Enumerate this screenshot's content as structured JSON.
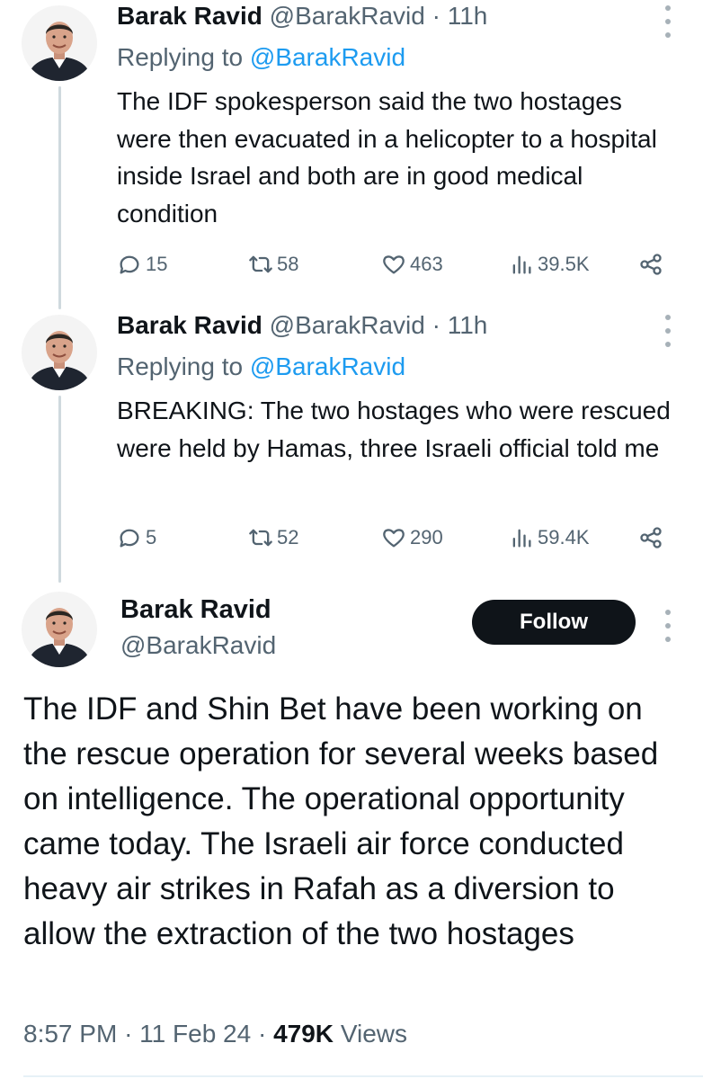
{
  "replies": [
    {
      "name": "Barak Ravid",
      "handle": "@BarakRavid",
      "dot": "·",
      "time": "11h",
      "replying_prefix": "Replying to",
      "replying_to": "@BarakRavid",
      "text": "The IDF spokesperson said the two hostages were then evacuated in a helicopter to a hospital inside Israel and both are in good medical condition",
      "replies_count": "15",
      "retweets_count": "58",
      "likes_count": "463",
      "views_count": "39.5K"
    },
    {
      "name": "Barak Ravid",
      "handle": "@BarakRavid",
      "dot": "·",
      "time": "11h",
      "replying_prefix": "Replying to",
      "replying_to": "@BarakRavid",
      "text": "BREAKING: The two hostages who were rescued were held by Hamas, three Israeli official told me",
      "replies_count": "5",
      "retweets_count": "52",
      "likes_count": "290",
      "views_count": "59.4K"
    }
  ],
  "main": {
    "name": "Barak Ravid",
    "handle": "@BarakRavid",
    "follow_label": "Follow",
    "text": "The IDF and Shin Bet have been working on the rescue operation for several weeks based on intelligence. The operational opportunity came today. The Israeli air force conducted heavy air strikes in Rafah as a diversion to allow the extraction of the two hostages",
    "time": "8:57 PM",
    "dot": "·",
    "date": "11 Feb 24",
    "views_count": "479K",
    "views_label": "Views"
  },
  "icons": {
    "reply": "reply-icon",
    "retweet": "retweet-icon",
    "like": "heart-icon",
    "views": "views-icon",
    "share": "share-icon",
    "more": "more-options-icon"
  },
  "colors": {
    "text": "#0f1419",
    "secondary": "#536471",
    "link": "#1d9bf0",
    "thread_line": "#cfd9de",
    "follow_bg": "#0f1419",
    "follow_text": "#ffffff"
  }
}
